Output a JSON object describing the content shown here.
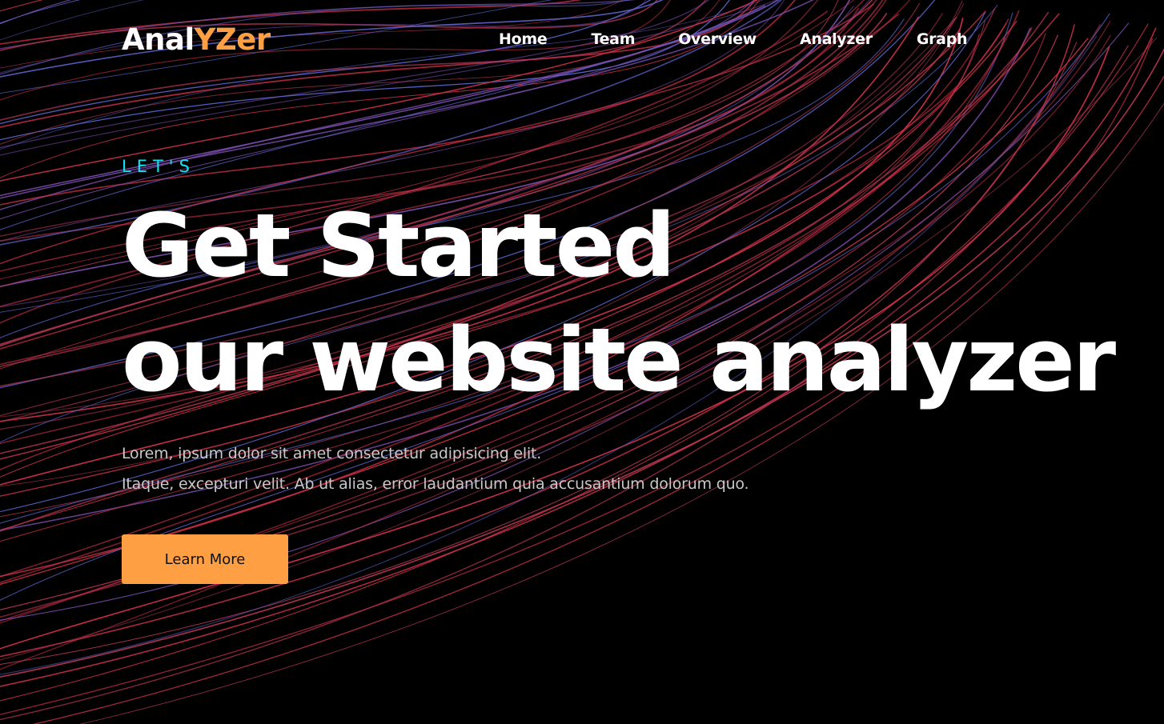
{
  "brand": {
    "logo_part_a": "Anal",
    "logo_part_b": "YZer",
    "accent_color": "#ff9f43",
    "eyebrow_color": "#12e2f2"
  },
  "nav": {
    "items": [
      {
        "label": "Home"
      },
      {
        "label": "Team"
      },
      {
        "label": "Overview"
      },
      {
        "label": "Analyzer"
      },
      {
        "label": "Graph"
      }
    ]
  },
  "hero": {
    "eyebrow": "LET'S",
    "headline_line1": "Get Started",
    "headline_line2": "our website analyzer",
    "description_line1": "Lorem, ipsum dolor sit amet consectetur adipisicing elit.",
    "description_line2": "Itaque, excepturi velit. Ab ut alias, error laudantium quia accusantium dolorum quo.",
    "cta_label": "Learn More"
  },
  "background": {
    "colors": [
      "#d2324a",
      "#b03550",
      "#5a63c8",
      "#7d4fb0"
    ]
  }
}
